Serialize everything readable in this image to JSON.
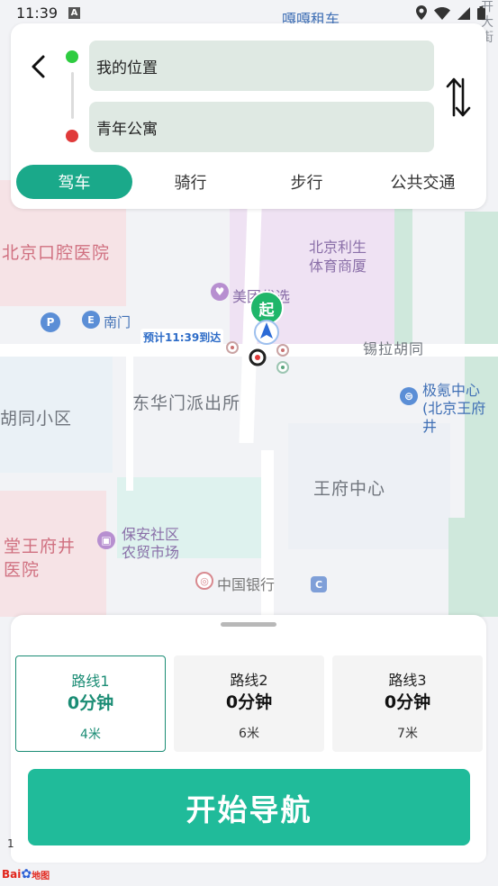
{
  "status_bar": {
    "time": "11:39",
    "notification_icon": "A"
  },
  "route_planner": {
    "from_value": "我的位置",
    "to_value": "青年公寓",
    "modes": [
      {
        "label": "驾车",
        "active": true
      },
      {
        "label": "骑行",
        "active": false
      },
      {
        "label": "步行",
        "active": false
      },
      {
        "label": "公共交通",
        "active": false
      }
    ]
  },
  "map": {
    "labels": {
      "taxi": "嘎嘎租车",
      "street_top": "开\n大\n街",
      "dental_hospital": "北京口腔医院",
      "lisheng": "北京利生\n体育商厦",
      "meituan": "美团优选",
      "south_gate": "南门",
      "xila_hutong": "锡拉胡同",
      "donghuamen": "东华门派出所",
      "jike": "极氪中心\n(北京王府井",
      "hutong_district": "胡同小区",
      "wangfu_center": "王府中心",
      "baoan": "保安社区\n农贸市场",
      "tang_wangfujing": "堂王府井\n医院",
      "boc": "中国银行",
      "start_marker": "起",
      "eta": "预计11:39到达"
    },
    "scale_text": "1",
    "logo_text": "Bai",
    "logo_suffix": "地图",
    "accent_color": "#20bb9a",
    "start_color": "#2ecc40",
    "end_color": "#e03a3a"
  },
  "routes": [
    {
      "name": "路线1",
      "time": "0分钟",
      "distance": "4米",
      "active": true
    },
    {
      "name": "路线2",
      "time": "0分钟",
      "distance": "6米",
      "active": false
    },
    {
      "name": "路线3",
      "time": "0分钟",
      "distance": "7米",
      "active": false
    }
  ],
  "start_navigation_label": "开始导航"
}
